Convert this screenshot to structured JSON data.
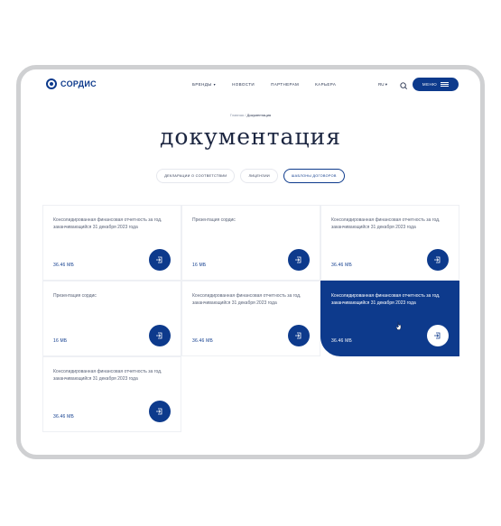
{
  "header": {
    "logo_text": "СОРДИС",
    "nav": [
      {
        "label": "БРЕНДЫ",
        "has_dropdown": true
      },
      {
        "label": "НОВОСТИ"
      },
      {
        "label": "ПАРТНЕРАМ"
      },
      {
        "label": "КАРЬЕРА"
      }
    ],
    "lang": "RU",
    "menu_label": "МЕНЮ"
  },
  "breadcrumb": {
    "home": "Главная",
    "separator": "/",
    "current": "Документация"
  },
  "page_title": "документация",
  "filters": [
    {
      "label": "ДЕКЛАРАЦИИ О СООТВЕТСТВИИ",
      "active": false
    },
    {
      "label": "ЛИЦЕНЗИИ",
      "active": false
    },
    {
      "label": "ШАБЛОНЫ ДОГОВОРОВ",
      "active": true
    }
  ],
  "documents": [
    {
      "title": "Консолидированная финансовая отчетность за год, заканчивающийся 31 декабря 2023 года",
      "size": "36.46 МБ",
      "highlighted": false
    },
    {
      "title": "Презентация сордис",
      "size": "16 МБ",
      "highlighted": false
    },
    {
      "title": "Консолидированная финансовая отчетность за год, заканчивающийся 31 декабря 2023 года",
      "size": "36.46 МБ",
      "highlighted": false
    },
    {
      "title": "Презентация сордис",
      "size": "16 МБ",
      "highlighted": false
    },
    {
      "title": "Консолидированная финансовая отчетность за год, заканчивающийся 31 декабря 2023 года",
      "size": "36.46 МБ",
      "highlighted": false
    },
    {
      "title": "Консолидированная финансовая отчетность за год, заканчивающийся 31 декабря 2023 года",
      "size": "36.46 МБ",
      "highlighted": true
    },
    {
      "title": "Консолидированная финансовая отчетность за год, заканчивающийся 31 декабря 2023 года",
      "size": "36.46 МБ",
      "highlighted": false
    }
  ],
  "colors": {
    "brand": "#0d3a8c",
    "frame": "#cfd0d2"
  },
  "icons": {
    "logo": "sordis-logo-icon",
    "search": "search-icon",
    "menu": "burger-menu-icon",
    "download": "download-icon",
    "cursor": "hand-cursor-icon"
  }
}
